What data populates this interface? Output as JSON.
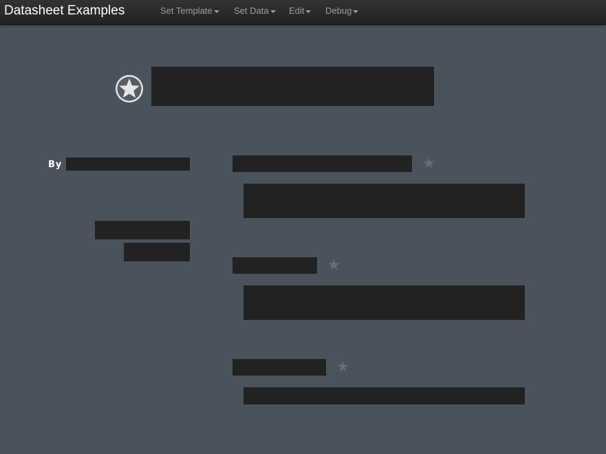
{
  "app": {
    "title": "Datasheet Examples"
  },
  "menu": {
    "set_template": "Set Template",
    "set_data": "Set Data",
    "edit": "Edit",
    "debug": "Debug"
  },
  "content": {
    "by_label": "By"
  },
  "icons": {
    "badge": "star-badge-icon",
    "field_star": "star-icon"
  },
  "colors": {
    "background": "#4a535c",
    "navbar": "#222222",
    "redaction": "#222222",
    "star_muted": "#656d75"
  }
}
